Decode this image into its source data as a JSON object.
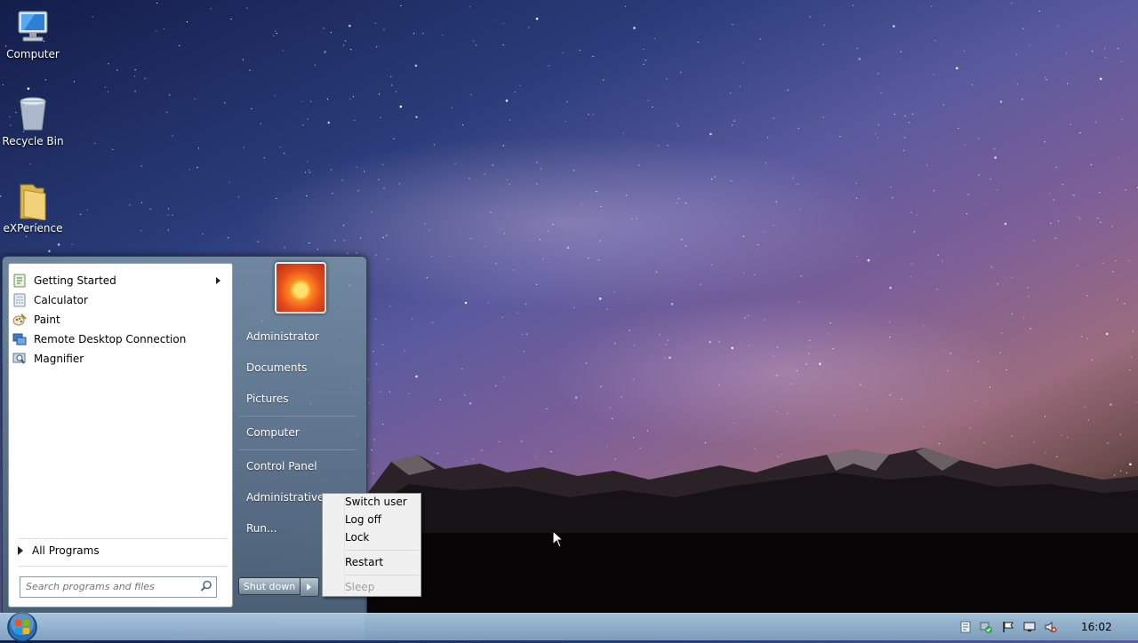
{
  "desktop": {
    "icons": [
      {
        "label": "Computer",
        "icon": "computer-icon"
      },
      {
        "label": "Recycle Bin",
        "icon": "recycle-bin-icon"
      },
      {
        "label": "eXPerience",
        "icon": "folder-icon"
      }
    ]
  },
  "start_menu": {
    "programs": [
      {
        "label": "Getting Started",
        "icon": "getting-started-icon",
        "has_submenu": true
      },
      {
        "label": "Calculator",
        "icon": "calculator-icon"
      },
      {
        "label": "Paint",
        "icon": "paint-icon"
      },
      {
        "label": "Remote Desktop Connection",
        "icon": "remote-desktop-icon"
      },
      {
        "label": "Magnifier",
        "icon": "magnifier-icon"
      }
    ],
    "all_programs": "All Programs",
    "search_placeholder": "Search programs and files",
    "right_items": [
      "Administrator",
      "Documents",
      "Pictures",
      "Computer",
      "Control Panel",
      "Administrative T",
      "Run..."
    ],
    "shutdown_label": "Shut down"
  },
  "shutdown_menu": {
    "items": [
      "Switch user",
      "Log off",
      "Lock",
      "Restart",
      "Sleep"
    ],
    "disabled": [
      "Sleep"
    ]
  },
  "taskbar": {
    "clock": "16:02",
    "tray_icons": [
      "network-icon",
      "security-icon",
      "action-center-flag-icon",
      "display-icon",
      "speaker-muted-icon"
    ]
  },
  "colors": {
    "accent": "#6f8597",
    "taskbar": "#a9c4dc",
    "disabled_text": "#a0a0a0"
  }
}
